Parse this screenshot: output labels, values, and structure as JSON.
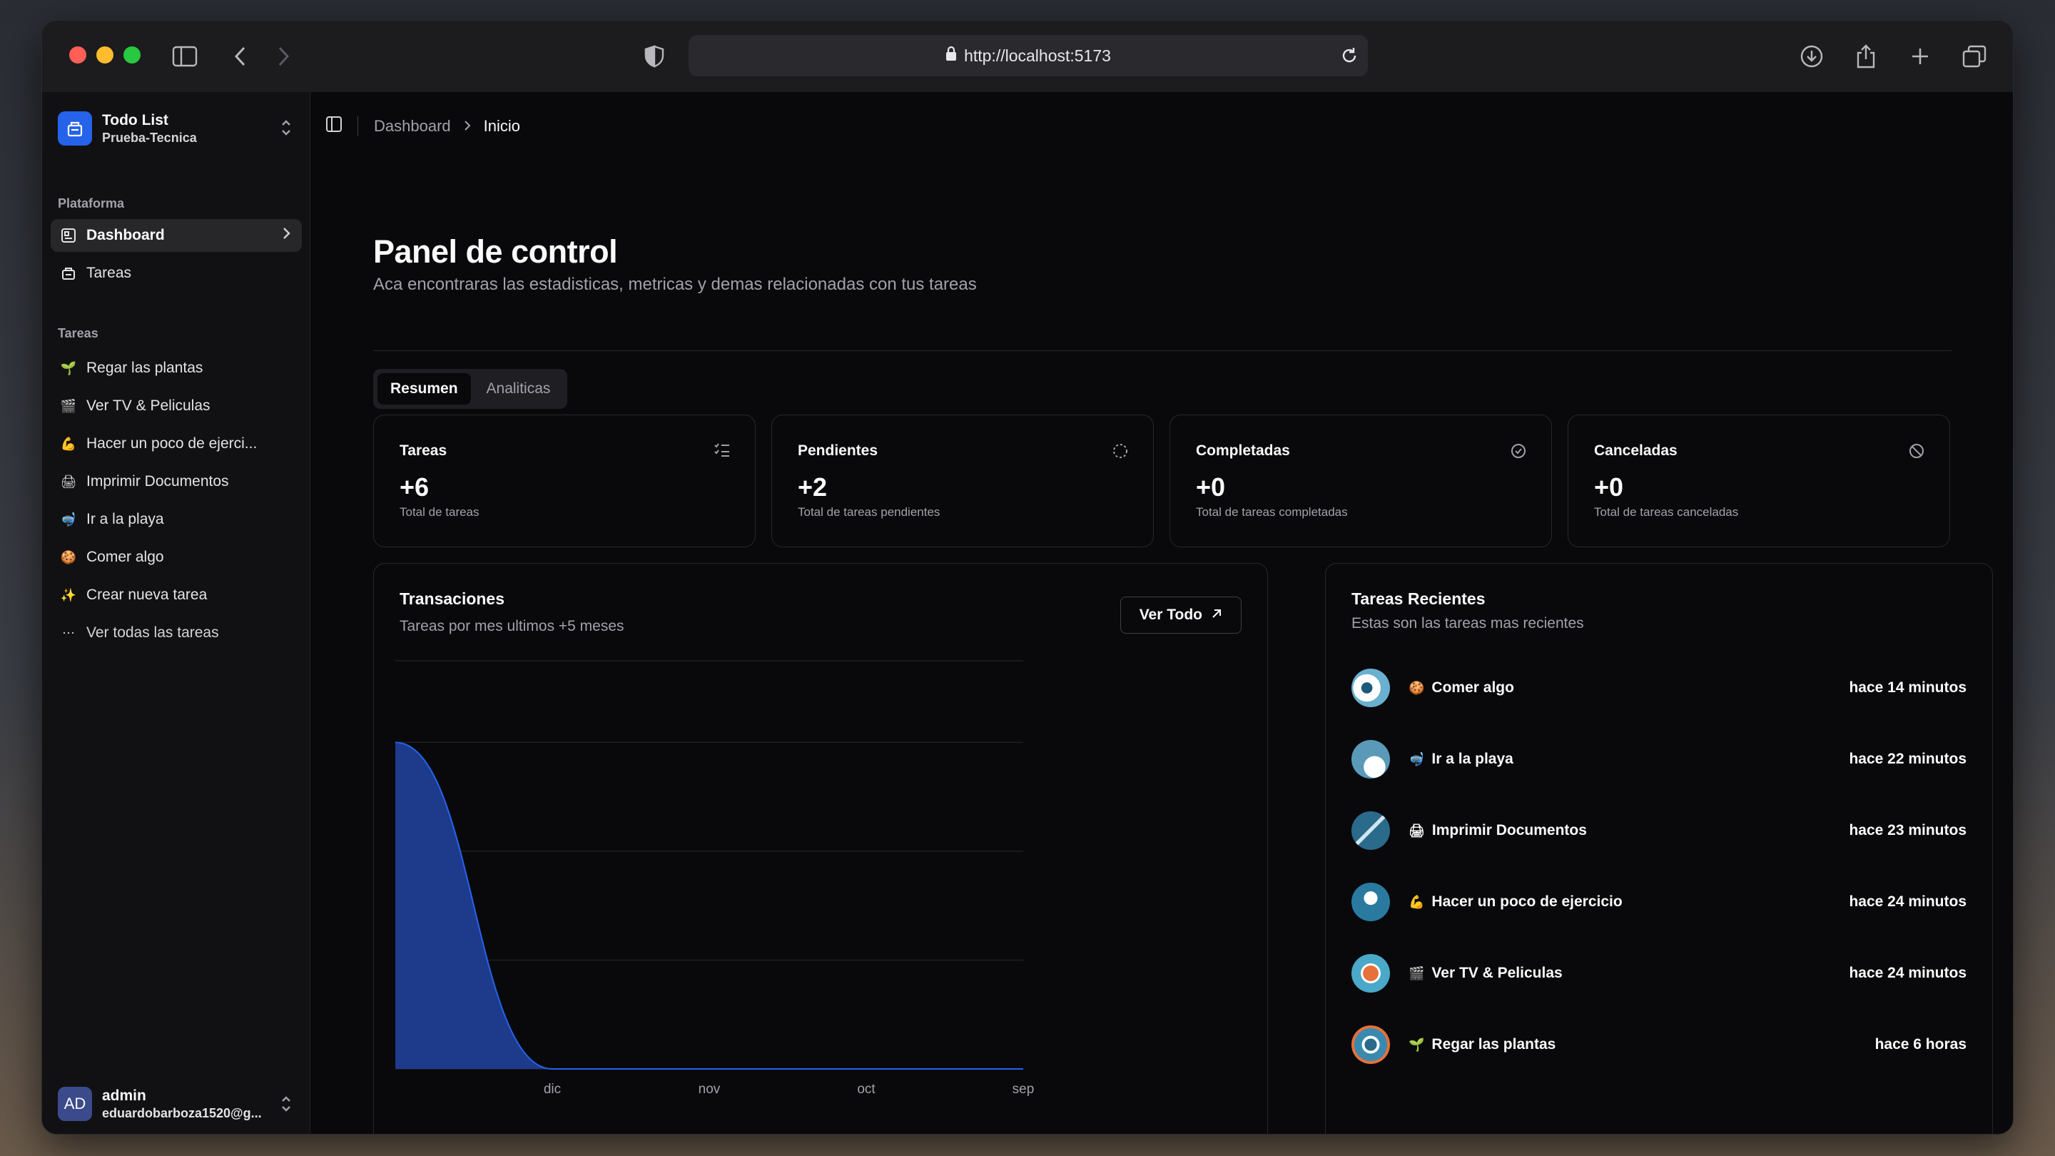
{
  "browser": {
    "url": "http://localhost:5173"
  },
  "sidebar": {
    "team_name": "Todo List",
    "team_sub": "Prueba-Tecnica",
    "platform_label": "Plataforma",
    "nav": [
      {
        "label": "Dashboard",
        "icon": "dashboard-icon"
      },
      {
        "label": "Tareas",
        "icon": "tasks-icon"
      }
    ],
    "tasks_label": "Tareas",
    "tasks": [
      {
        "emoji": "🌱",
        "label": "Regar las plantas"
      },
      {
        "emoji": "🎬",
        "label": "Ver TV & Peliculas"
      },
      {
        "emoji": "💪",
        "label": "Hacer un poco de ejerci..."
      },
      {
        "emoji": "🖨",
        "label": "Imprimir Documentos"
      },
      {
        "emoji": "🤿",
        "label": "Ir a la playa"
      },
      {
        "emoji": "🍪",
        "label": "Comer algo"
      },
      {
        "emoji": "✨",
        "label": "Crear nueva tarea"
      },
      {
        "emoji": "⋯",
        "label": "Ver todas las tareas"
      }
    ],
    "user": {
      "initials": "AD",
      "name": "admin",
      "email": "eduardobarboza1520@g..."
    }
  },
  "breadcrumb": {
    "parent": "Dashboard",
    "current": "Inicio"
  },
  "page": {
    "title": "Panel de control",
    "subtitle": "Aca encontraras las estadisticas, metricas y demas relacionadas con tus tareas"
  },
  "tabs": [
    "Resumen",
    "Analiticas"
  ],
  "stats": [
    {
      "title": "Tareas",
      "value": "+6",
      "desc": "Total de tareas",
      "icon": "list-check-icon"
    },
    {
      "title": "Pendientes",
      "value": "+2",
      "desc": "Total de tareas pendientes",
      "icon": "loader-icon"
    },
    {
      "title": "Completadas",
      "value": "+0",
      "desc": "Total de tareas completadas",
      "icon": "check-circle-icon"
    },
    {
      "title": "Canceladas",
      "value": "+0",
      "desc": "Total de tareas canceladas",
      "icon": "ban-icon"
    }
  ],
  "transactions": {
    "title": "Transaciones",
    "subtitle": "Tareas por mes ultimos +5 meses",
    "button": "Ver Todo"
  },
  "chart_data": {
    "type": "area",
    "categories": [
      "",
      "dic",
      "nov",
      "oct",
      "sep"
    ],
    "values": [
      6,
      0,
      0,
      0,
      0
    ],
    "ylim": [
      0,
      7.5
    ],
    "grid": true,
    "color": "#1e3a8a",
    "stroke": "#2563eb"
  },
  "recent": {
    "title": "Tareas Recientes",
    "subtitle": "Estas son las tareas mas recientes",
    "items": [
      {
        "emoji": "🍪",
        "name": "Comer algo",
        "time": "hace 14 minutos"
      },
      {
        "emoji": "🤿",
        "name": "Ir a la playa",
        "time": "hace 22 minutos"
      },
      {
        "emoji": "🖨",
        "name": "Imprimir Documentos",
        "time": "hace 23 minutos"
      },
      {
        "emoji": "💪",
        "name": "Hacer un poco de ejercicio",
        "time": "hace 24 minutos"
      },
      {
        "emoji": "🎬",
        "name": "Ver TV & Peliculas",
        "time": "hace 24 minutos"
      },
      {
        "emoji": "🌱",
        "name": "Regar las plantas",
        "time": "hace 6 horas"
      }
    ]
  }
}
